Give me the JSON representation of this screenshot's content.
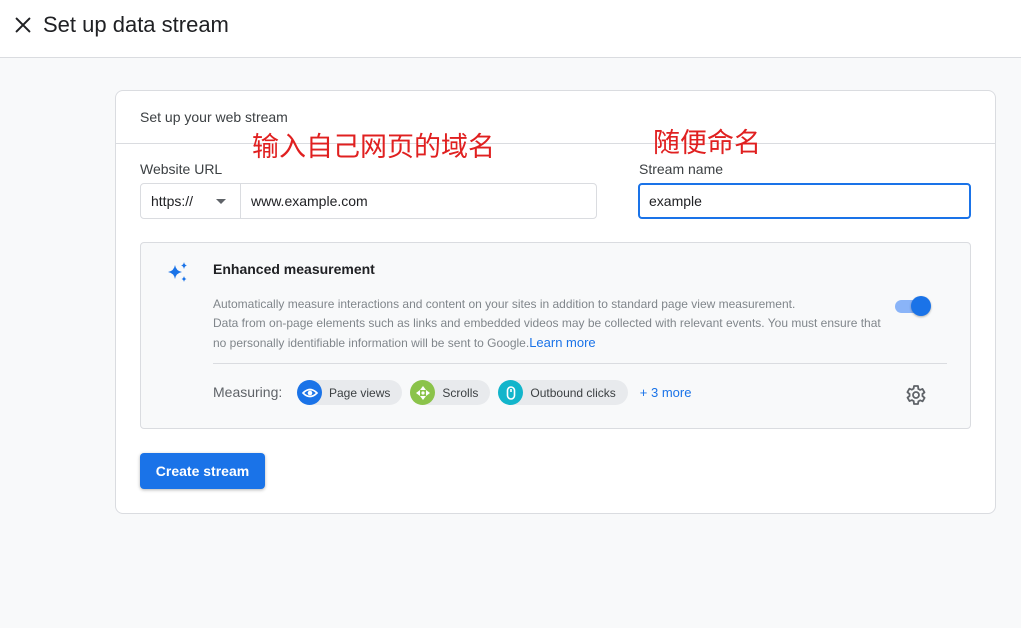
{
  "header": {
    "title": "Set up data stream",
    "close_icon": "close-icon"
  },
  "card": {
    "header": "Set up your web stream",
    "annotations": {
      "url_note": "输入自己网页的域名",
      "name_note": "随便命名"
    },
    "website_url": {
      "label": "Website URL",
      "protocol": "https://",
      "value": "www.example.com"
    },
    "stream_name": {
      "label": "Stream name",
      "value": "example"
    },
    "enhanced": {
      "icon": "sparkle-icon",
      "title": "Enhanced measurement",
      "desc_line1": "Automatically measure interactions and content on your sites in addition to standard page view measurement.",
      "desc_line2": "Data from on-page elements such as links and embedded videos may be collected with relevant events. You must ensure that no personally identifiable information will be sent to Google.",
      "learn_more": "Learn more",
      "toggle_on": true,
      "measuring_label": "Measuring:",
      "chips": [
        {
          "label": "Page views",
          "icon": "eye-icon",
          "color": "#1a73e8"
        },
        {
          "label": "Scrolls",
          "icon": "scroll-icon",
          "color": "#8bc34a"
        },
        {
          "label": "Outbound clicks",
          "icon": "mouse-icon",
          "color": "#12b5cb"
        }
      ],
      "more": "+ 3 more",
      "settings_icon": "gear-icon"
    },
    "create_button": "Create stream"
  },
  "colors": {
    "accent": "#1a73e8",
    "annotation": "#e02020"
  }
}
